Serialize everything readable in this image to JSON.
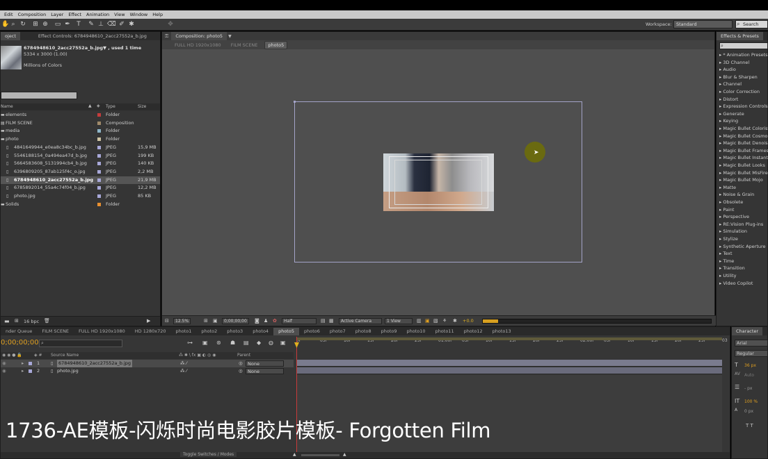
{
  "menu": [
    "Edit",
    "Composition",
    "Layer",
    "Effect",
    "Animation",
    "View",
    "Window",
    "Help"
  ],
  "toolbar": {
    "workspace_label": "Workspace:",
    "workspace_value": "Standard",
    "search_placeholder": "Search Help"
  },
  "project": {
    "tabs": [
      "oject",
      "Effect Controls: 6784948610_2acc27552a_b.jpg"
    ],
    "selected_name": "6784948610_2acc27552a_b.jpg▼ , used 1 time",
    "selected_dims": "5334 x 3000 (1.00)",
    "selected_colors": "Millions of Colors",
    "headers": {
      "name": "Name",
      "type": "Type",
      "size": "Size"
    },
    "items": [
      {
        "name": "elements",
        "type": "Folder",
        "size": "",
        "color": "#c63c3c",
        "indent": 0,
        "icon": "folder-icon"
      },
      {
        "name": "FILM SCENE",
        "type": "Composition",
        "size": "",
        "color": "#a08a6a",
        "indent": 0,
        "icon": "composition-icon"
      },
      {
        "name": "media",
        "type": "Folder",
        "size": "",
        "color": "#8fb6c9",
        "indent": 0,
        "icon": "folder-icon"
      },
      {
        "name": "photo",
        "type": "Folder",
        "size": "",
        "color": "#cfc4a4",
        "indent": 0,
        "icon": "folder-icon"
      },
      {
        "name": "4841649944_e0ea8c34bc_b.jpg",
        "type": "JPEG",
        "size": "15,9 MB",
        "color": "#a8a8d8",
        "indent": 1,
        "icon": "image-file-icon"
      },
      {
        "name": "5546188154_0a494ea47d_b.jpg",
        "type": "JPEG",
        "size": "199 KB",
        "color": "#a8a8d8",
        "indent": 1,
        "icon": "image-file-icon"
      },
      {
        "name": "5664583608_5131994cb4_b.jpg",
        "type": "JPEG",
        "size": "140 KB",
        "color": "#a8a8d8",
        "indent": 1,
        "icon": "image-file-icon"
      },
      {
        "name": "6396809205_87ab125f4c_o.jpg",
        "type": "JPEG",
        "size": "2,2 MB",
        "color": "#a8a8d8",
        "indent": 1,
        "icon": "image-file-icon"
      },
      {
        "name": "6784948610_2acc27552a_b.jpg",
        "type": "JPEG",
        "size": "21,9 MB",
        "color": "#a8a8d8",
        "indent": 1,
        "selected": true,
        "icon": "image-file-icon"
      },
      {
        "name": "6785892014_55a4c74f04_b.jpg",
        "type": "JPEG",
        "size": "12,2 MB",
        "color": "#a8a8d8",
        "indent": 1,
        "icon": "image-file-icon"
      },
      {
        "name": "photo.jpg",
        "type": "JPEG",
        "size": "85 KB",
        "color": "#a8a8d8",
        "indent": 1,
        "icon": "image-file-icon"
      },
      {
        "name": "Solids",
        "type": "Folder",
        "size": "",
        "color": "#e89030",
        "indent": 0,
        "icon": "folder-icon"
      }
    ],
    "bpc": "16 bpc"
  },
  "composition": {
    "tab": "Composition: photo5",
    "breadcrumbs": [
      "FULL HD 1920x1080",
      "FILM SCENE",
      "photo5"
    ],
    "zoom": "12.5%",
    "timecode": "0;00;00;00",
    "resolution": "Half",
    "camera": "Active Camera",
    "views": "1 View",
    "exposure": "+0.0"
  },
  "effects": {
    "title": "Effects & Presets",
    "items": [
      "* Animation Presets",
      "3D Channel",
      "Audio",
      "Blur & Sharpen",
      "Channel",
      "Color Correction",
      "Distort",
      "Expression Controls",
      "Generate",
      "Keying",
      "Magic Bullet Colorista",
      "Magic Bullet Cosmo",
      "Magic Bullet Denoiser",
      "Magic Bullet Frames",
      "Magic Bullet InstantHD",
      "Magic Bullet Looks",
      "Magic Bullet MisFire",
      "Magic Bullet Mojo",
      "Matte",
      "Noise & Grain",
      "Obsolete",
      "Paint",
      "Perspective",
      "RE:Vision Plug-ins",
      "Simulation",
      "Stylize",
      "Synthetic Aperture",
      "Text",
      "Time",
      "Transition",
      "Utility",
      "Video Copilot"
    ]
  },
  "timeline": {
    "tabs": [
      "nder Queue",
      "FILM SCENE",
      "FULL HD 1920x1080",
      "HD 1280x720",
      "photo1",
      "photo2",
      "photo3",
      "photo4",
      "photo5",
      "photo6",
      "photo7",
      "photo8",
      "photo9",
      "photo10",
      "photo11",
      "photo12",
      "photo13"
    ],
    "active_tab": "photo5",
    "timecode": "0;00;00;00",
    "column_source": "Source Name",
    "column_parent": "Parent",
    "ruler": [
      "0F",
      "05f",
      "10f",
      "15f",
      "20f",
      "25f",
      "01:00f",
      "05f",
      "10f",
      "15f",
      "20f",
      "25f",
      "02:00f",
      "05f",
      "10f",
      "15f",
      "20f",
      "25f",
      "03"
    ],
    "layers": [
      {
        "num": "1",
        "name": "6784948610_2acc27552a_b.jpg",
        "parent": "None"
      },
      {
        "num": "2",
        "name": "photo.jpg",
        "parent": "None"
      }
    ],
    "toggle_label": "Toggle Switches / Modes"
  },
  "character": {
    "title": "Character",
    "font": "Arial",
    "style": "Regular",
    "size": "36 px",
    "leading": "Auto",
    "tracking": "- px",
    "scale": "100 %",
    "baseline": "0 px"
  },
  "caption": "1736-AE模板-闪烁时尚电影胶片模板- Forgotten Film"
}
